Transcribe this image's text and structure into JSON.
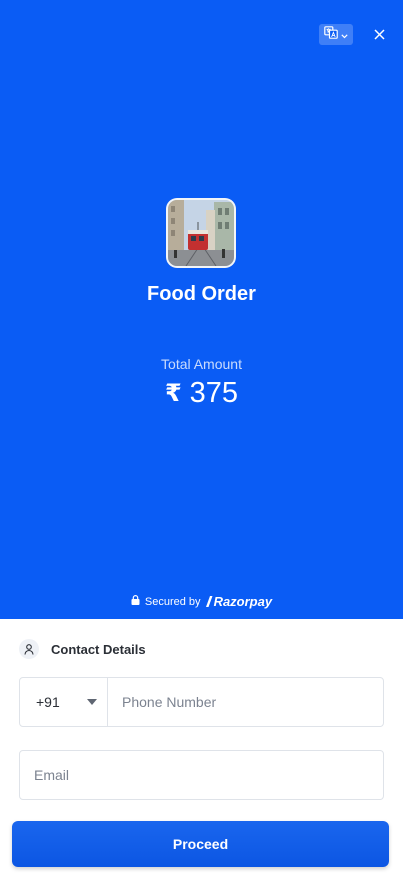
{
  "header": {
    "language_icon": "translate-icon",
    "dropdown_icon": "chevron-down-icon",
    "close_icon": "close-icon",
    "close_glyph": "✕"
  },
  "merchant": {
    "logo": "tram-photo",
    "name": "Food Order"
  },
  "payment": {
    "amount_label": "Total Amount",
    "currency_symbol": "₹",
    "amount": "375"
  },
  "footer_badge": {
    "icon": "lock-icon",
    "secured_text": "Secured by",
    "brand": "Razorpay"
  },
  "contact": {
    "icon": "user-icon",
    "title": "Contact Details",
    "country_code": "+91",
    "phone_placeholder": "Phone Number",
    "email_placeholder": "Email"
  },
  "actions": {
    "proceed_label": "Proceed"
  },
  "colors": {
    "primary": "#0a5cf5",
    "button": "#0c56e3",
    "text": "#2b2f36",
    "border": "#dfe3e9"
  }
}
